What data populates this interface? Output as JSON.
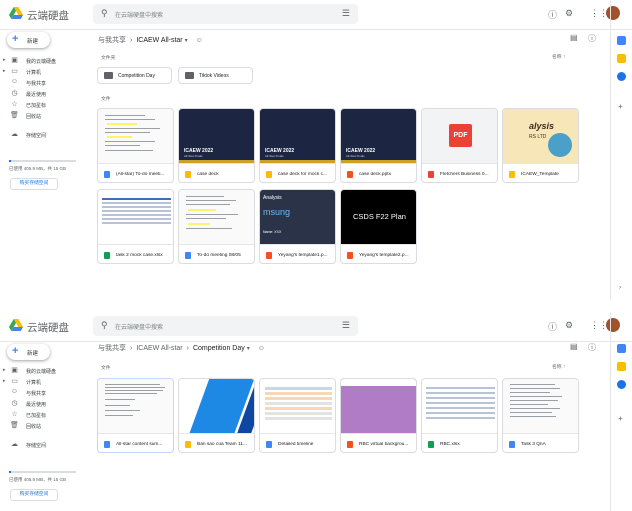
{
  "app": {
    "title": "云端硬盘",
    "search_placeholder": "在云端硬盘中搜索",
    "new_label": "新建",
    "brand_colors": {
      "blue": "#4285f4",
      "red": "#ea4335",
      "yellow": "#fbbc04",
      "green": "#34a853"
    },
    "header_icons": [
      "search-icon",
      "tune-icon",
      "help-icon",
      "settings-icon",
      "apps-icon",
      "avatar"
    ]
  },
  "sidebar": {
    "items": [
      {
        "label": "我的云端硬盘",
        "icon": "drive-icon"
      },
      {
        "label": "计算机",
        "icon": "computer-icon"
      },
      {
        "label": "与我共享",
        "icon": "people-icon"
      },
      {
        "label": "最近使用",
        "icon": "clock-icon"
      },
      {
        "label": "已加星标",
        "icon": "star-icon"
      },
      {
        "label": "回收站",
        "icon": "trash-icon"
      }
    ],
    "storage_label": "存储空间",
    "storage_used": "已使用 405.9 MB，共 15 GB",
    "storage_fraction": 0.027,
    "buy_storage": "购买存储空间"
  },
  "view1": {
    "breadcrumb": {
      "root": "与我共享",
      "current": "ICAEW All-star"
    },
    "folders_label": "文件夹",
    "files_label": "文件",
    "sort_label": "名称",
    "folders": [
      {
        "name": "Competition Day"
      },
      {
        "name": "Tiktok Videos"
      }
    ],
    "files": [
      {
        "name": "(All-star) To-do meeti...",
        "type": "doc",
        "thumb": "doc"
      },
      {
        "name": "case deck",
        "type": "slides",
        "thumb": "dark",
        "thumb_title": "ICAEW 2022",
        "thumb_sub": "All-Star Finals"
      },
      {
        "name": "case deck for mock c...",
        "type": "slides",
        "thumb": "dark",
        "thumb_title": "ICAEW 2022",
        "thumb_sub": "All-Star Finals"
      },
      {
        "name": "case deck.pptx",
        "type": "pptx",
        "thumb": "dark",
        "thumb_title": "ICAEW 2022",
        "thumb_sub": "All-Star Finals"
      },
      {
        "name": "Fletchers Business 0...",
        "type": "pdf",
        "thumb": "pdf",
        "thumb_title": "PDF"
      },
      {
        "name": "ICAEW_Template",
        "type": "slides",
        "thumb": "tpl",
        "thumb_title": "alysis",
        "thumb_sub": "RS LTD"
      },
      {
        "name": "task 2 mock case.xlsx",
        "type": "xlsx",
        "thumb": "sheet"
      },
      {
        "name": "To-do meeting 08/05",
        "type": "doc",
        "thumb": "doc"
      },
      {
        "name": "Yeyang's template1.p...",
        "type": "pptx",
        "thumb": "city",
        "thumb_title": "Analysis",
        "thumb_sub": "msung",
        "thumb_note": "Name: XXX"
      },
      {
        "name": "Yeyang's template2.p...",
        "type": "pptx",
        "thumb": "black",
        "thumb_title": "CSDS F22 Plan"
      }
    ]
  },
  "view2": {
    "breadcrumb": {
      "root": "与我共享",
      "mid": "ICAEW All-star",
      "current": "Competition Day"
    },
    "files_label": "文件",
    "sort_label": "名称",
    "files": [
      {
        "name": "All-star content sum...",
        "type": "doc",
        "thumb": "doc"
      },
      {
        "name": "Bản sao của Team 11...",
        "type": "slides",
        "thumb": "blue"
      },
      {
        "name": "Detailed timeline",
        "type": "doc",
        "thumb": "table"
      },
      {
        "name": "RBC virtual backgrou...",
        "type": "pptx",
        "thumb": "purple"
      },
      {
        "name": "RBC.xlsx",
        "type": "xlsx",
        "thumb": "sheet"
      },
      {
        "name": "Task 3 QnA",
        "type": "doc",
        "thumb": "doc"
      }
    ]
  },
  "type_colors": {
    "doc": "#4285f4",
    "slides": "#fbbc04",
    "pptx": "#f4511e",
    "pdf": "#ea4335",
    "xlsx": "#0f9d58"
  }
}
